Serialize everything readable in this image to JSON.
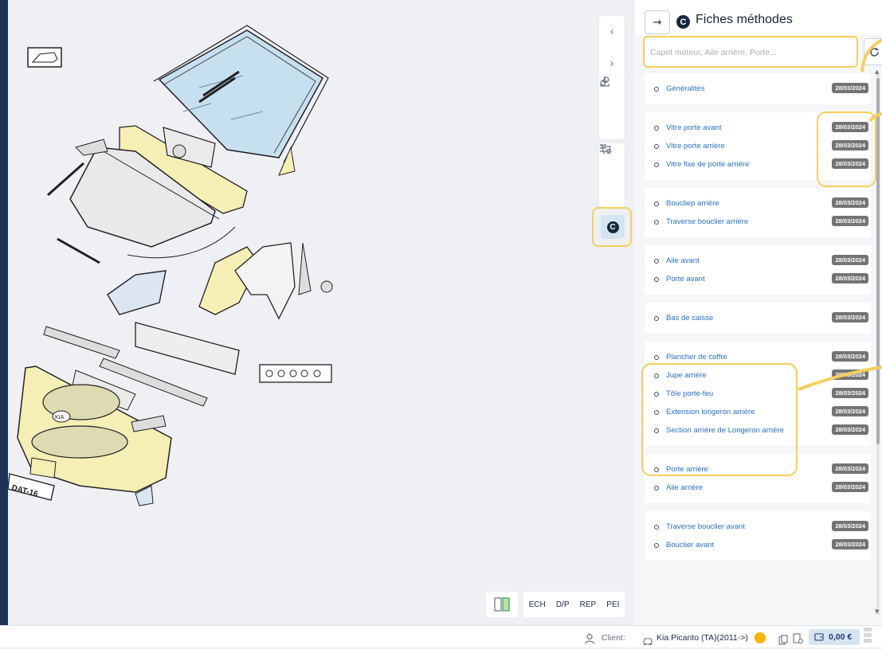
{
  "panel": {
    "title": "Fiches méthodes",
    "back_icon": "arrow-right-icon",
    "search": {
      "placeholder": "Capot moteur, Aile arrière, Porte...",
      "value": ""
    },
    "groups": [
      {
        "items": [
          {
            "label": "Généralités",
            "date": "28/03/2024"
          }
        ]
      },
      {
        "items": [
          {
            "label": "Vitre porte avant",
            "date": "28/03/2024"
          },
          {
            "label": "Vitre porte arrière",
            "date": "28/03/2024"
          },
          {
            "label": "Vitre fixe de porte arrière",
            "date": "28/03/2024"
          }
        ]
      },
      {
        "items": [
          {
            "label": "Boucliер arrière",
            "date": "28/03/2024"
          },
          {
            "label": "Traverse bouclier arrière",
            "date": "28/03/2024"
          }
        ]
      },
      {
        "items": [
          {
            "label": "Aile avant",
            "date": "28/03/2024"
          },
          {
            "label": "Porte avant",
            "date": "28/03/2024"
          }
        ]
      },
      {
        "items": [
          {
            "label": "Bas de caisse",
            "date": "28/03/2024"
          }
        ]
      },
      {
        "items": [
          {
            "label": "Plancher de coffre",
            "date": "28/03/2024"
          },
          {
            "label": "Jupe arrière",
            "date": "28/03/2024"
          },
          {
            "label": "Tôle porte-feu",
            "date": "28/03/2024"
          },
          {
            "label": "Extension longeron arrière",
            "date": "28/03/2024"
          },
          {
            "label": "Section arrière de Longeron arrière",
            "date": "28/03/2024"
          }
        ]
      },
      {
        "items": [
          {
            "label": "Porte arrière",
            "date": "28/03/2024"
          },
          {
            "label": "Aile arrière",
            "date": "28/03/2024"
          }
        ]
      },
      {
        "items": [
          {
            "label": "Traverse bouclier avant",
            "date": "28/03/2024"
          },
          {
            "label": "Bouclier avant",
            "date": "28/03/2024"
          }
        ]
      }
    ]
  },
  "toolbar": {
    "prev_label": "‹",
    "next_label": "›",
    "active_badge": "C",
    "icons": [
      "chevron-left-icon",
      "chevron-right-icon",
      "link-settings-icon",
      "download-icon",
      "list-settings-icon",
      "cart-icon",
      "methods-c-icon"
    ]
  },
  "category_tabs": [
    "ECH",
    "D/P",
    "REP",
    "PEI"
  ],
  "diagram": {
    "plate_text": "DAT-16",
    "grille_logo": "KIA"
  },
  "status_bar": {
    "client_label": "Client:",
    "vehicle": "Kia Picanto (TA)(2011->)",
    "amount": "0,00 €"
  },
  "colors": {
    "accent": "#2a6fc6",
    "highlight": "#f5cf5b",
    "status": "#f7b500",
    "dark": "#14283f",
    "date_badge": "#747474"
  }
}
